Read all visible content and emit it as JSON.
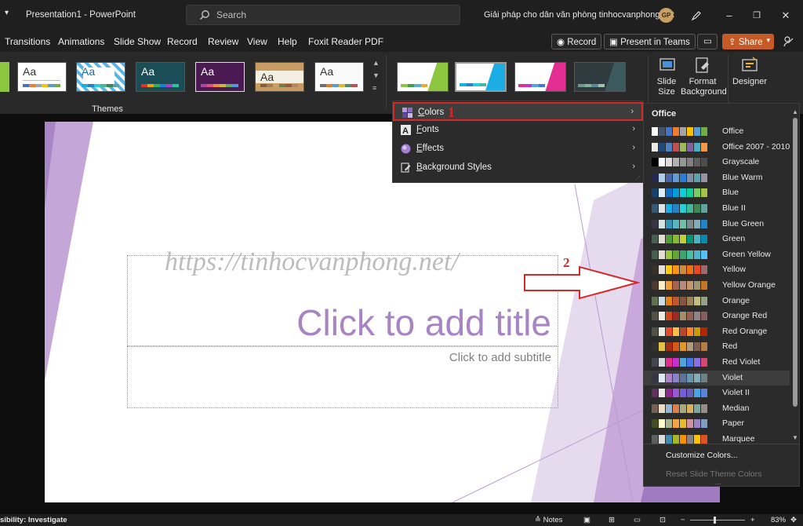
{
  "titlebar": {
    "doc_title": "Presentation1 - PowerPoint",
    "search_placeholder": "Search",
    "account_name": "Giải pháp cho dân văn phòng tinhocvanphong.net",
    "avatar_initials": "GP"
  },
  "menu": [
    "Transitions",
    "Animations",
    "Slide Show",
    "Record",
    "Review",
    "View",
    "Help",
    "Foxit Reader PDF"
  ],
  "toolbar": {
    "record_label": "Record",
    "present_teams_label": "Present in Teams",
    "share_label": "Share"
  },
  "ribbon": {
    "themes_group_label": "Themes",
    "theme_text": "Aa",
    "slide_size_label": [
      "Slide",
      "Size"
    ],
    "format_background_label": [
      "Format",
      "Background"
    ],
    "designer_label": "Designer"
  },
  "variants_menu": {
    "items": [
      {
        "label": "Colors",
        "underline": "C",
        "rest": "olors",
        "icon": "colors-icon"
      },
      {
        "label": "Fonts",
        "underline": "F",
        "rest": "onts",
        "icon": "fonts-icon"
      },
      {
        "label": "Effects",
        "underline": "E",
        "rest": "ffects",
        "icon": "effects-icon"
      },
      {
        "label": "Background Styles",
        "underline": "B",
        "rest": "ackground Styles",
        "icon": "background-styles-icon"
      }
    ]
  },
  "annotations": {
    "step1": "1",
    "step2": "2"
  },
  "slide": {
    "watermark": "https://tinhocvanphong.net/",
    "title_placeholder": "Click to add title",
    "subtitle_placeholder": "Click to add subtitle"
  },
  "colors_panel": {
    "header": "Office",
    "selected": "Violet",
    "schemes": [
      {
        "name": "Office",
        "sw": [
          "#ffffff",
          "#44546a",
          "#4472c4",
          "#ed7d31",
          "#a5a5a5",
          "#ffc000",
          "#5b9bd5",
          "#70ad47"
        ]
      },
      {
        "name": "Office 2007 - 2010",
        "sw": [
          "#eeece1",
          "#1f497d",
          "#4f81bd",
          "#c0504d",
          "#9bbb59",
          "#8064a2",
          "#4bacc6",
          "#f79646"
        ]
      },
      {
        "name": "Grayscale",
        "sw": [
          "#000000",
          "#f8f8f8",
          "#dddddd",
          "#b2b2b2",
          "#969696",
          "#808080",
          "#5f5f5f",
          "#4d4d4d"
        ]
      },
      {
        "name": "Blue Warm",
        "sw": [
          "#242852",
          "#acccea",
          "#4a66ac",
          "#629dd1",
          "#297fd5",
          "#7f8fa9",
          "#5aa2ae",
          "#9d90a0"
        ]
      },
      {
        "name": "Blue",
        "sw": [
          "#17406d",
          "#dbeff9",
          "#0f6fc6",
          "#009dd9",
          "#0bd0d9",
          "#10cf9b",
          "#7cca62",
          "#a5c249"
        ]
      },
      {
        "name": "Blue II",
        "sw": [
          "#335b74",
          "#dfe3e5",
          "#1cade4",
          "#2683c6",
          "#27ced7",
          "#42ba97",
          "#3e8853",
          "#62a39f"
        ]
      },
      {
        "name": "Blue Green",
        "sw": [
          "#373545",
          "#cee5e2",
          "#3494ba",
          "#58b6c0",
          "#75bda7",
          "#7a8c8e",
          "#84acb6",
          "#2683c6"
        ]
      },
      {
        "name": "Green",
        "sw": [
          "#455f51",
          "#e3ded1",
          "#549e39",
          "#8ab833",
          "#c0cf3a",
          "#029676",
          "#4ab5c4",
          "#0989b1"
        ]
      },
      {
        "name": "Green Yellow",
        "sw": [
          "#455f51",
          "#e3ded1",
          "#99cb38",
          "#63a537",
          "#37a76f",
          "#44c1a3",
          "#4eb3cf",
          "#51c3f9"
        ]
      },
      {
        "name": "Yellow",
        "sw": [
          "#39302a",
          "#e5dedb",
          "#ffca08",
          "#f8931d",
          "#ce8d3e",
          "#ec7016",
          "#e64823",
          "#9c6a6a"
        ]
      },
      {
        "name": "Yellow Orange",
        "sw": [
          "#4e3b30",
          "#fbeec9",
          "#f0a22e",
          "#a5644e",
          "#b58b80",
          "#c3986d",
          "#a19574",
          "#c17529"
        ]
      },
      {
        "name": "Orange",
        "sw": [
          "#637052",
          "#ccddea",
          "#e48312",
          "#bd582c",
          "#865640",
          "#9b8357",
          "#c2bc80",
          "#94a088"
        ]
      },
      {
        "name": "Orange Red",
        "sw": [
          "#505046",
          "#eeece1",
          "#d34817",
          "#9b2d1f",
          "#a28e6a",
          "#956251",
          "#918485",
          "#855d5d"
        ]
      },
      {
        "name": "Red Orange",
        "sw": [
          "#505046",
          "#eeece1",
          "#e84c22",
          "#ffbd47",
          "#b64926",
          "#ff8427",
          "#cc9900",
          "#b22600"
        ]
      },
      {
        "name": "Red",
        "sw": [
          "#323232",
          "#e5c243",
          "#a5300f",
          "#d55816",
          "#e19825",
          "#b19c7d",
          "#7f5f52",
          "#b27d49"
        ]
      },
      {
        "name": "Red Violet",
        "sw": [
          "#454551",
          "#d8d9dc",
          "#e32d91",
          "#c830cc",
          "#4ea6dc",
          "#4775e7",
          "#8971e1",
          "#d54773"
        ]
      },
      {
        "name": "Violet",
        "sw": [
          "#373545",
          "#dceaf4",
          "#ad84c6",
          "#8784c7",
          "#5d739a",
          "#6997af",
          "#84acb6",
          "#6f8183"
        ]
      },
      {
        "name": "Violet II",
        "sw": [
          "#632e62",
          "#eaeaea",
          "#92278f",
          "#9b57d3",
          "#755dd9",
          "#665eb8",
          "#45a5ed",
          "#5982db"
        ]
      },
      {
        "name": "Median",
        "sw": [
          "#775f55",
          "#ebddc3",
          "#94b6d2",
          "#dd8047",
          "#a5ab81",
          "#d8b25c",
          "#7ba79d",
          "#968c8c"
        ]
      },
      {
        "name": "Paper",
        "sw": [
          "#444d26",
          "#fefac9",
          "#a5b592",
          "#f3a447",
          "#e7bc29",
          "#d092a7",
          "#9c85c0",
          "#809ec2"
        ]
      },
      {
        "name": "Marquee",
        "sw": [
          "#5e5e5e",
          "#dddddd",
          "#418ab3",
          "#a6b727",
          "#f69200",
          "#838383",
          "#fec306",
          "#df5327"
        ]
      }
    ],
    "customize_label": "Customize Colors...",
    "reset_label": "Reset Slide Theme Colors"
  },
  "statusbar": {
    "accessibility": "sibility: Investigate",
    "notes_label": "Notes",
    "zoom": "83%"
  }
}
